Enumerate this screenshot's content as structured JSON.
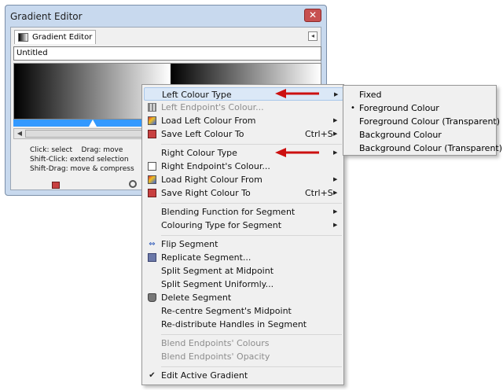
{
  "window": {
    "title": "Gradient Editor",
    "close_glyph": "✕",
    "tab_label": "Gradient Editor",
    "panel_menu_glyph": "◂",
    "gradient_name": "Untitled",
    "hints": [
      "Click: select    Drag: move",
      "Shift-Click: extend selection",
      "Shift-Drag: move & compress"
    ],
    "icons": [
      "save-icon",
      "zoom-icon"
    ]
  },
  "menu": {
    "items": [
      {
        "label": "Left Colour Type",
        "submenu": true,
        "highlighted": true
      },
      {
        "label": "Left Endpoint's Colour...",
        "disabled": true,
        "icon": "grid-icon"
      },
      {
        "label": "Load Left Colour From",
        "submenu": true,
        "icon": "load-icon"
      },
      {
        "label": "Save Left Colour To",
        "accel": "Ctrl+S",
        "submenu": true,
        "icon": "save-icon"
      },
      {
        "label": "Right Colour Type",
        "submenu": true
      },
      {
        "label": "Right Endpoint's Colour...",
        "icon": "checkbox-icon"
      },
      {
        "label": "Load Right Colour From",
        "submenu": true,
        "icon": "load-icon"
      },
      {
        "label": "Save Right Colour To",
        "accel": "Ctrl+S",
        "submenu": true,
        "icon": "save-icon"
      },
      {
        "label": "Blending Function for Segment",
        "submenu": true
      },
      {
        "label": "Colouring Type for Segment",
        "submenu": true
      },
      {
        "label": "Flip Segment",
        "icon": "flip-icon"
      },
      {
        "label": "Replicate Segment...",
        "icon": "replicate-icon"
      },
      {
        "label": "Split Segment at Midpoint"
      },
      {
        "label": "Split Segment Uniformly..."
      },
      {
        "label": "Delete Segment",
        "icon": "delete-icon"
      },
      {
        "label": "Re-centre Segment's Midpoint"
      },
      {
        "label": "Re-distribute Handles in Segment"
      },
      {
        "label": "Blend Endpoints' Colours",
        "disabled": true
      },
      {
        "label": "Blend Endpoints' Opacity",
        "disabled": true
      },
      {
        "label": "Edit Active Gradient",
        "checked": true,
        "icon": "check-icon"
      }
    ],
    "arrow_glyph": "▶",
    "flip_glyph": "⇔",
    "check_glyph": "✔"
  },
  "submenu": {
    "items": [
      {
        "label": "Fixed"
      },
      {
        "label": "Foreground Colour",
        "selected": true
      },
      {
        "label": "Foreground Colour (Transparent)"
      },
      {
        "label": "Background Colour"
      },
      {
        "label": "Background Colour (Transparent)"
      }
    ],
    "bullet_glyph": "•"
  },
  "colors": {
    "highlight": "#dbe8f7",
    "handle_bar": "#3399ff",
    "annotation_red": "#cc1010"
  }
}
